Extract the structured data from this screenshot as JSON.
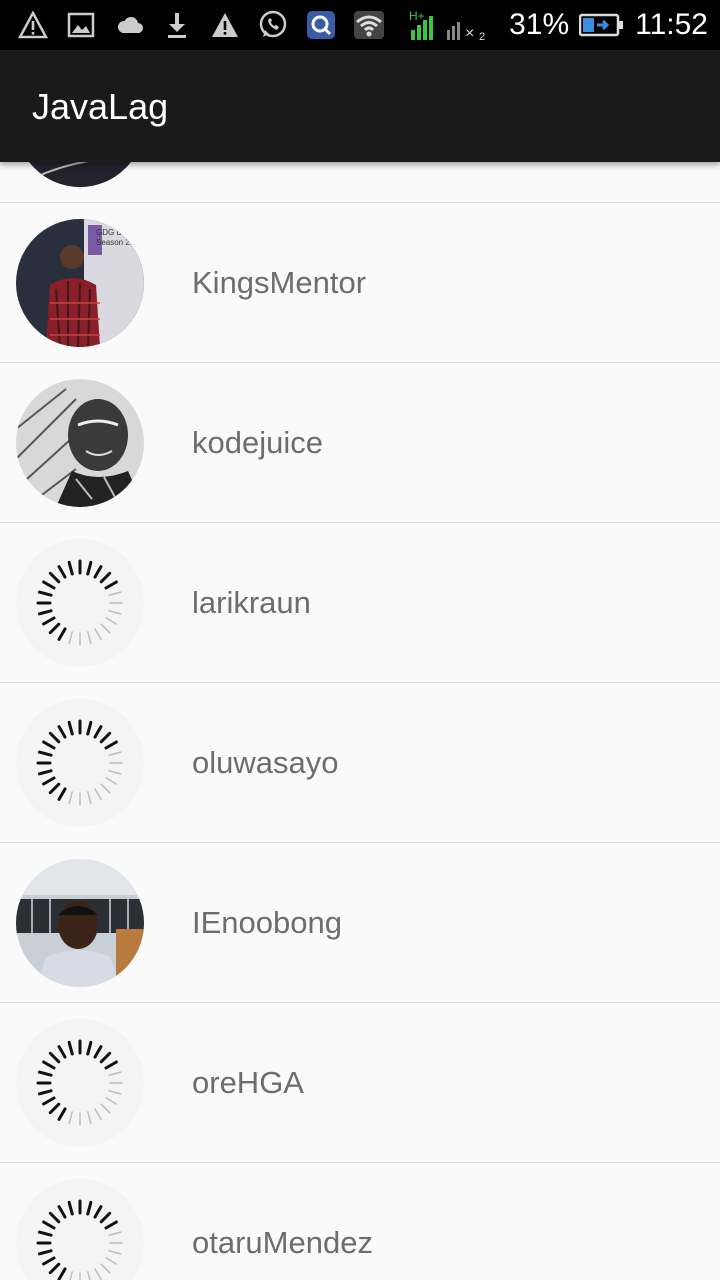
{
  "status_bar": {
    "icons": [
      "warning-icon",
      "image-icon",
      "cloud-icon",
      "download-icon",
      "warning-icon",
      "whatsapp-icon",
      "search-app-icon",
      "wifi-icon"
    ],
    "network": "H+",
    "battery": "31%",
    "time": "11:52"
  },
  "app_bar": {
    "title": "JavaLag"
  },
  "users": [
    {
      "username": "KingsMentor",
      "avatar": "photo-presenter"
    },
    {
      "username": "kodejuice",
      "avatar": "photo-sketch"
    },
    {
      "username": "larikraun",
      "avatar": "loading"
    },
    {
      "username": "oluwasayo",
      "avatar": "loading"
    },
    {
      "username": "IEnoobong",
      "avatar": "photo-portrait"
    },
    {
      "username": "oreHGA",
      "avatar": "loading"
    },
    {
      "username": "otaruMendez",
      "avatar": "loading"
    }
  ]
}
